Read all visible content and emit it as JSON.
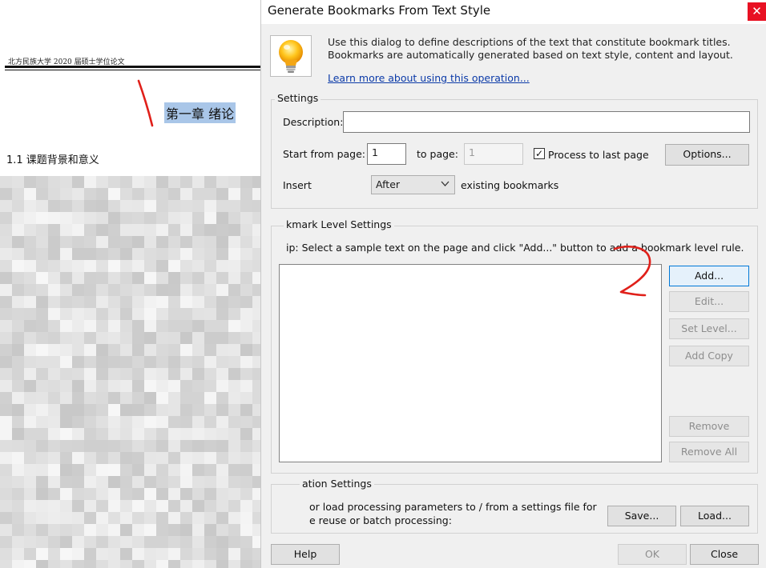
{
  "document": {
    "header": "北方民族大学 2020 届硕士学位论文",
    "chapter": "第一章  绪论",
    "section": "1.1  课题背景和意义"
  },
  "dialog": {
    "title": "Generate Bookmarks From Text Style",
    "close_glyph": "✕",
    "intro_text": "Use this dialog to define descriptions of the text that constitute bookmark titles. Bookmarks are automatically generated based on text style, content and layout.",
    "learn_link": "Learn more about using this operation...",
    "icon": "lightbulb-icon",
    "settings": {
      "group_title": "Settings",
      "description_label": "Description:",
      "description_value": "",
      "start_label": "Start from page:",
      "start_value": "1",
      "to_label": "to page:",
      "to_value": "1",
      "process_label": "Process to last page",
      "process_checked": true,
      "options_button": "Options...",
      "insert_label": "Insert",
      "insert_value": "After",
      "insert_suffix": "existing bookmarks"
    },
    "levels": {
      "group_title": "kmark Level Settings",
      "tip": "ip: Select a sample text on the page and click \"Add...\" button to add a bookmark level rule.",
      "add_button": "Add...",
      "edit_button": "Edit...",
      "set_level_button": "Set Level...",
      "add_copy_button": "Add Copy",
      "remove_button": "Remove",
      "remove_all_button": "Remove All",
      "rules": []
    },
    "configuration": {
      "group_title": "ation Settings",
      "line1": "or load processing parameters to / from a settings file for",
      "line2": "e reuse or batch processing:",
      "save_button": "Save...",
      "load_button": "Load..."
    },
    "footer": {
      "help_button": "Help",
      "ok_button": "OK",
      "close_button": "Close"
    }
  },
  "colors": {
    "dialog_bg": "#f0f0f0",
    "close_red": "#e81123",
    "link_blue": "#0b3aa8",
    "annotation_red": "#e0201a",
    "selection_blue": "#a9c6e8"
  }
}
